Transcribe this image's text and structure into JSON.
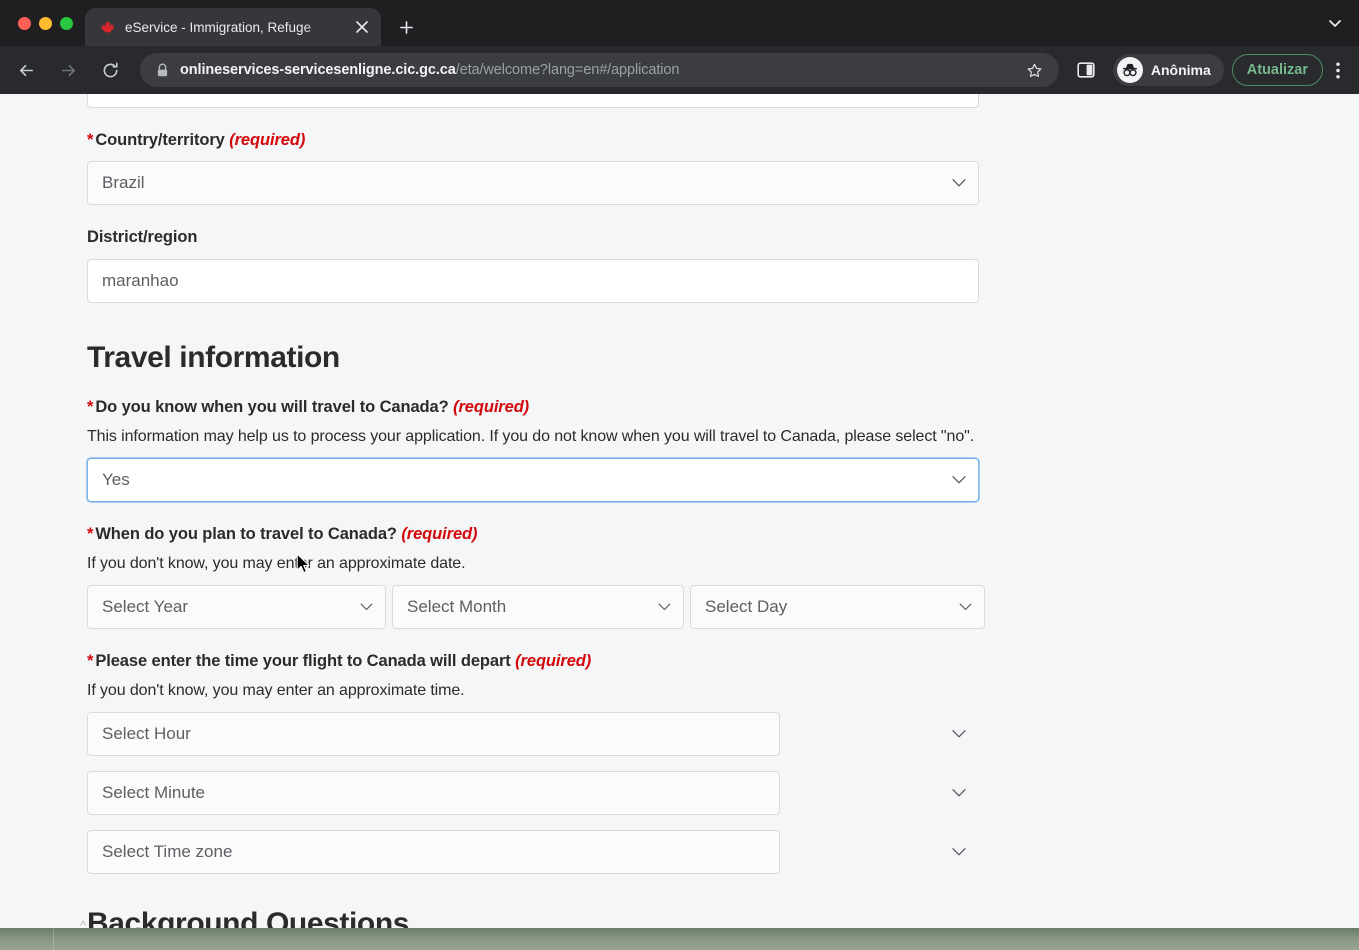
{
  "browser": {
    "tab": {
      "title": "eService - Immigration, Refuge",
      "favicon_name": "maple-leaf-favicon",
      "close_label": "×"
    },
    "new_tab_label": "+",
    "window_controls": {
      "close": "close",
      "minimize": "minimize",
      "maximize": "maximize"
    },
    "toolbar": {
      "back_label": "Back",
      "forward_label": "Forward",
      "reload_label": "Reload",
      "url_host": "onlineservices-servicesenligne.cic.gc.ca",
      "url_path": "/eta/welcome?lang=en#/application",
      "bookmark_label": "Bookmark this tab",
      "side_panel_label": "Side panel",
      "incognito_label": "Anônima",
      "update_label": "Atualizar",
      "menu_label": "Customize and control Google Chrome"
    },
    "colors": {
      "chrome_bg": "#1f1f22",
      "toolbar_bg": "#292a2d",
      "tab_active_bg": "#37373b",
      "omnibox_bg": "#3b3d41",
      "update_accent": "#76b98d",
      "page_bg": "#f5f6f7"
    }
  },
  "page": {
    "required_suffix": "(required)",
    "fields": {
      "country": {
        "label": "Country/territory",
        "required": true,
        "value": "Brazil"
      },
      "district": {
        "label": "District/region",
        "required": false,
        "value": "maranhao"
      }
    },
    "travel_section": {
      "title": "Travel information",
      "know_travel_date": {
        "label": "Do you know when you will travel to Canada?",
        "required": true,
        "helper": "This information may help us to process your application. If you do not know when you will travel to Canada, please select \"no\".",
        "value": "Yes",
        "focused": true
      },
      "travel_date": {
        "label": "When do you plan to travel to Canada?",
        "required": true,
        "helper": "If you don't know, you may enter an approximate date.",
        "year": "Select Year",
        "month": "Select Month",
        "day": "Select Day"
      },
      "flight_time": {
        "label": "Please enter the time your flight to Canada will depart",
        "required": true,
        "helper": "If you don't know, you may enter an approximate time.",
        "hour": "Select Hour",
        "minute": "Select Minute",
        "timezone": "Select Time zone"
      }
    },
    "background_section": {
      "title": "Background Questions"
    },
    "back_to_top_label": "^"
  }
}
